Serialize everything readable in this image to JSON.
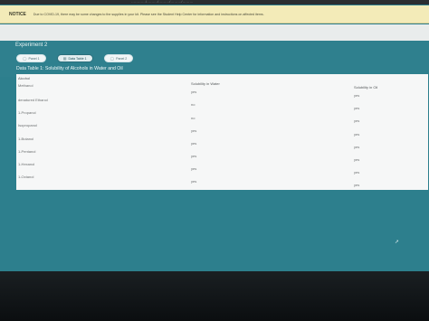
{
  "browser": {
    "url_fragment": "…………/………/………/………/………"
  },
  "notice": {
    "label": "NOTICE",
    "text": "Due to COVID-19, there may be some changes to the supplies in your kit. Please see the Student Help Center for information and instructions on affected items."
  },
  "experiment": {
    "title": "Experiment 2"
  },
  "tabs": [
    {
      "label": "Panel 1",
      "icon": "circle-icon"
    },
    {
      "label": "Data Table 1",
      "icon": "table-icon"
    },
    {
      "label": "Panel 2",
      "icon": "circle-icon"
    }
  ],
  "table": {
    "title": "Data Table 1: Solubility of Alcohols in Water and Oil",
    "headers": [
      "Alcohol",
      "Solubility in Water",
      "Solubility in Oil"
    ],
    "rows": [
      {
        "alcohol": "Methanol",
        "water": "yes",
        "oil": "yes"
      },
      {
        "alcohol": "denatured Ethanol",
        "water": "no",
        "oil": "yes"
      },
      {
        "alcohol": "1-Propanol",
        "water": "no",
        "oil": "yes"
      },
      {
        "alcohol": "Isopropanol",
        "water": "yes",
        "oil": "yes"
      },
      {
        "alcohol": "1-Butanol",
        "water": "yes",
        "oil": "yes"
      },
      {
        "alcohol": "1-Pentanol",
        "water": "yes",
        "oil": "yes"
      },
      {
        "alcohol": "1-Hexanol",
        "water": "yes",
        "oil": "yes"
      },
      {
        "alcohol": "1-Octanol",
        "water": "yes",
        "oil": "yes"
      }
    ]
  },
  "colors": {
    "teal": "#2d7f8d",
    "notice_bg": "#f3ebb8",
    "table_bg": "#f6f7f7"
  }
}
